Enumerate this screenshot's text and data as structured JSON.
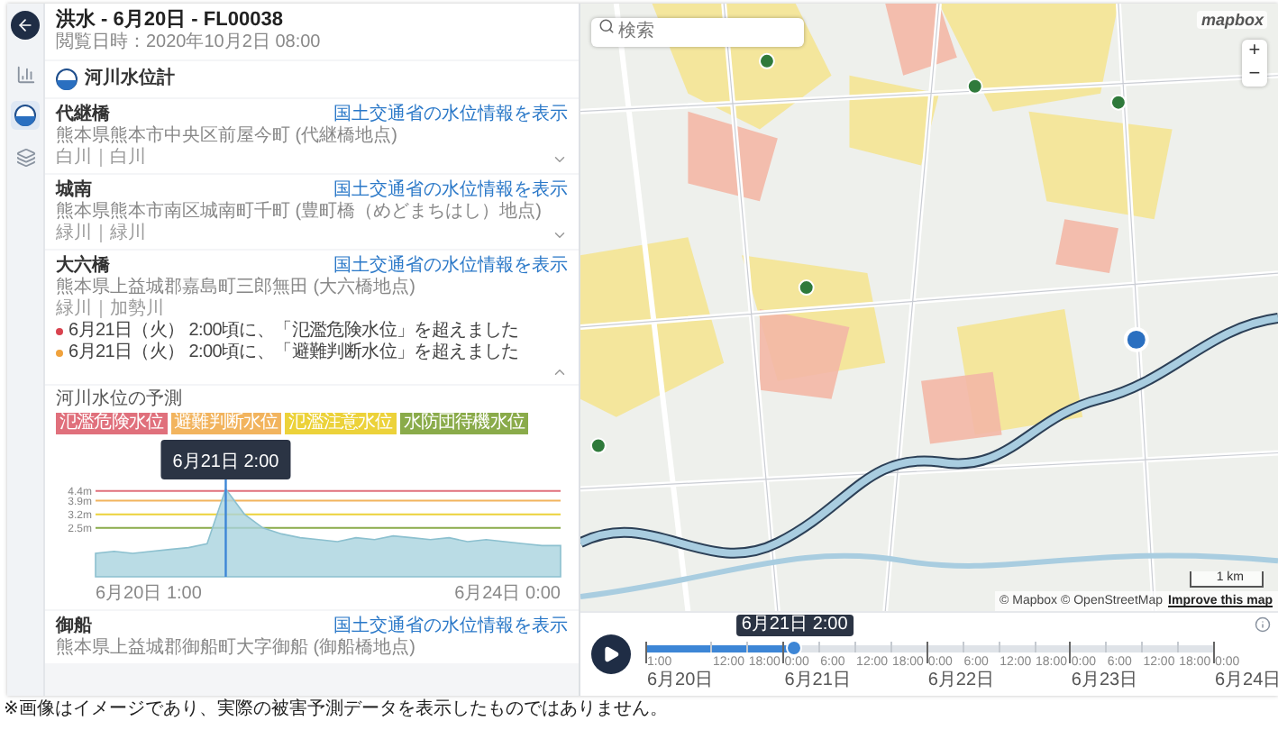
{
  "sidebar_rail": {
    "items": [
      {
        "kind": "chart",
        "selected": false
      },
      {
        "kind": "gauge",
        "selected": true
      },
      {
        "kind": "layers",
        "selected": false
      }
    ]
  },
  "panel": {
    "title": "洪水 - 6月20日 - FL00038",
    "viewed_at": "閲覧日時：2020年10月2日 08:00",
    "section_title": "河川水位計",
    "items": [
      {
        "kind": "station",
        "name": "代継橋",
        "link": "国土交通省の水位情報を表示",
        "address": "熊本県熊本市中央区前屋今町 (代継橋地点)",
        "river": "白川｜白川",
        "expanded": false
      },
      {
        "kind": "station",
        "name": "城南",
        "link": "国土交通省の水位情報を表示",
        "address": "熊本県熊本市南区城南町千町 (豊町橋（めどまちはし）地点)",
        "river": "緑川｜緑川",
        "expanded": false
      },
      {
        "kind": "station",
        "name": "大六橋",
        "link": "国土交通省の水位情報を表示",
        "address": "熊本県上益城郡嘉島町三郎無田 (大六橋地点)",
        "river": "緑川｜加勢川",
        "expanded": true,
        "alerts": [
          {
            "text": "6月21日（火） 2:00頃に、「氾濫危険水位」を超えました",
            "color": "#d9434f"
          },
          {
            "text": "6月21日（火） 2:00頃に、「避難判断水位」を超えました",
            "color": "#f0a23c"
          }
        ]
      },
      {
        "kind": "forecast",
        "title": "河川水位の予測",
        "legend": [
          {
            "label": "氾濫危険水位",
            "color": "#e0707c"
          },
          {
            "label": "避難判断水位",
            "color": "#f2b45e"
          },
          {
            "label": "氾濫注意水位",
            "color": "#ecd23a"
          },
          {
            "label": "水防団待機水位",
            "color": "#8aab4a"
          }
        ],
        "threshold_labels": [
          "4.4m",
          "3.9m",
          "3.2m",
          "2.5m"
        ],
        "start_label": "6月20日 1:00",
        "end_label": "6月24日 0:00",
        "cursor_label": "6月21日 2:00"
      },
      {
        "kind": "station",
        "name": "御船",
        "link": "国土交通省の水位情報を表示",
        "address": "熊本県上益城郡御船町大字御船 (御船橋地点)"
      }
    ]
  },
  "map": {
    "search": {
      "placeholder": "検索"
    },
    "logo": "mapbox",
    "zoom_in": "+",
    "zoom_out": "−",
    "scale": "1 km",
    "attribution": "© Mapbox © OpenStreetMap",
    "attribution_link": "Improve this map"
  },
  "timeline": {
    "cursor_label": "6月21日 2:00",
    "level": 0.263,
    "ticks": [
      {
        "time": "1:00",
        "date": "6月20日"
      },
      {
        "time": "12:00"
      },
      {
        "time": "18:00"
      },
      {
        "time": "0:00",
        "date": "6月21日"
      },
      {
        "time": "6:00"
      },
      {
        "time": "12:00"
      },
      {
        "time": "18:00"
      },
      {
        "time": "0:00",
        "date": "6月22日"
      },
      {
        "time": "6:00"
      },
      {
        "time": "12:00"
      },
      {
        "time": "18:00"
      },
      {
        "time": "0:00",
        "date": "6月23日"
      },
      {
        "time": "6:00"
      },
      {
        "time": "12:00"
      },
      {
        "time": "18:00"
      },
      {
        "time": "0:00",
        "date": "6月24日"
      }
    ]
  },
  "caption": "※画像はイメージであり、実際の被害予測データを表示したものではありません。"
}
